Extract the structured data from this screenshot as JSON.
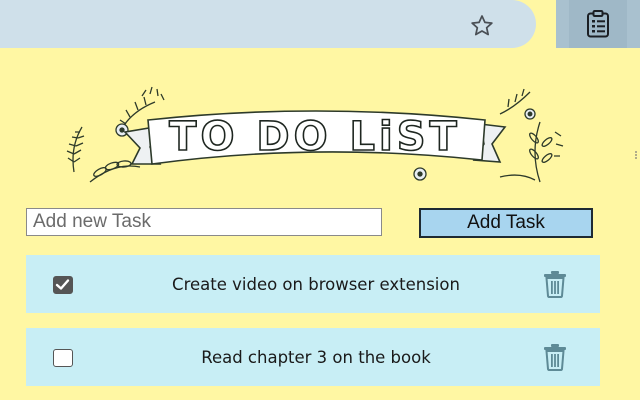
{
  "browser": {
    "star_icon": "star-outline",
    "extension_icon": "clipboard-list"
  },
  "banner": {
    "title": "TO DO LiST"
  },
  "new_task": {
    "placeholder": "Add new Task",
    "value": "",
    "button_label": "Add Task"
  },
  "tasks": [
    {
      "text": "Create video on browser extension",
      "done": true
    },
    {
      "text": "Read chapter 3 on the book",
      "done": false
    }
  ],
  "colors": {
    "background": "#fff7a3",
    "task_row": "#c8eef5",
    "button": "#a8d5ef",
    "trash": "#5e8a96"
  }
}
